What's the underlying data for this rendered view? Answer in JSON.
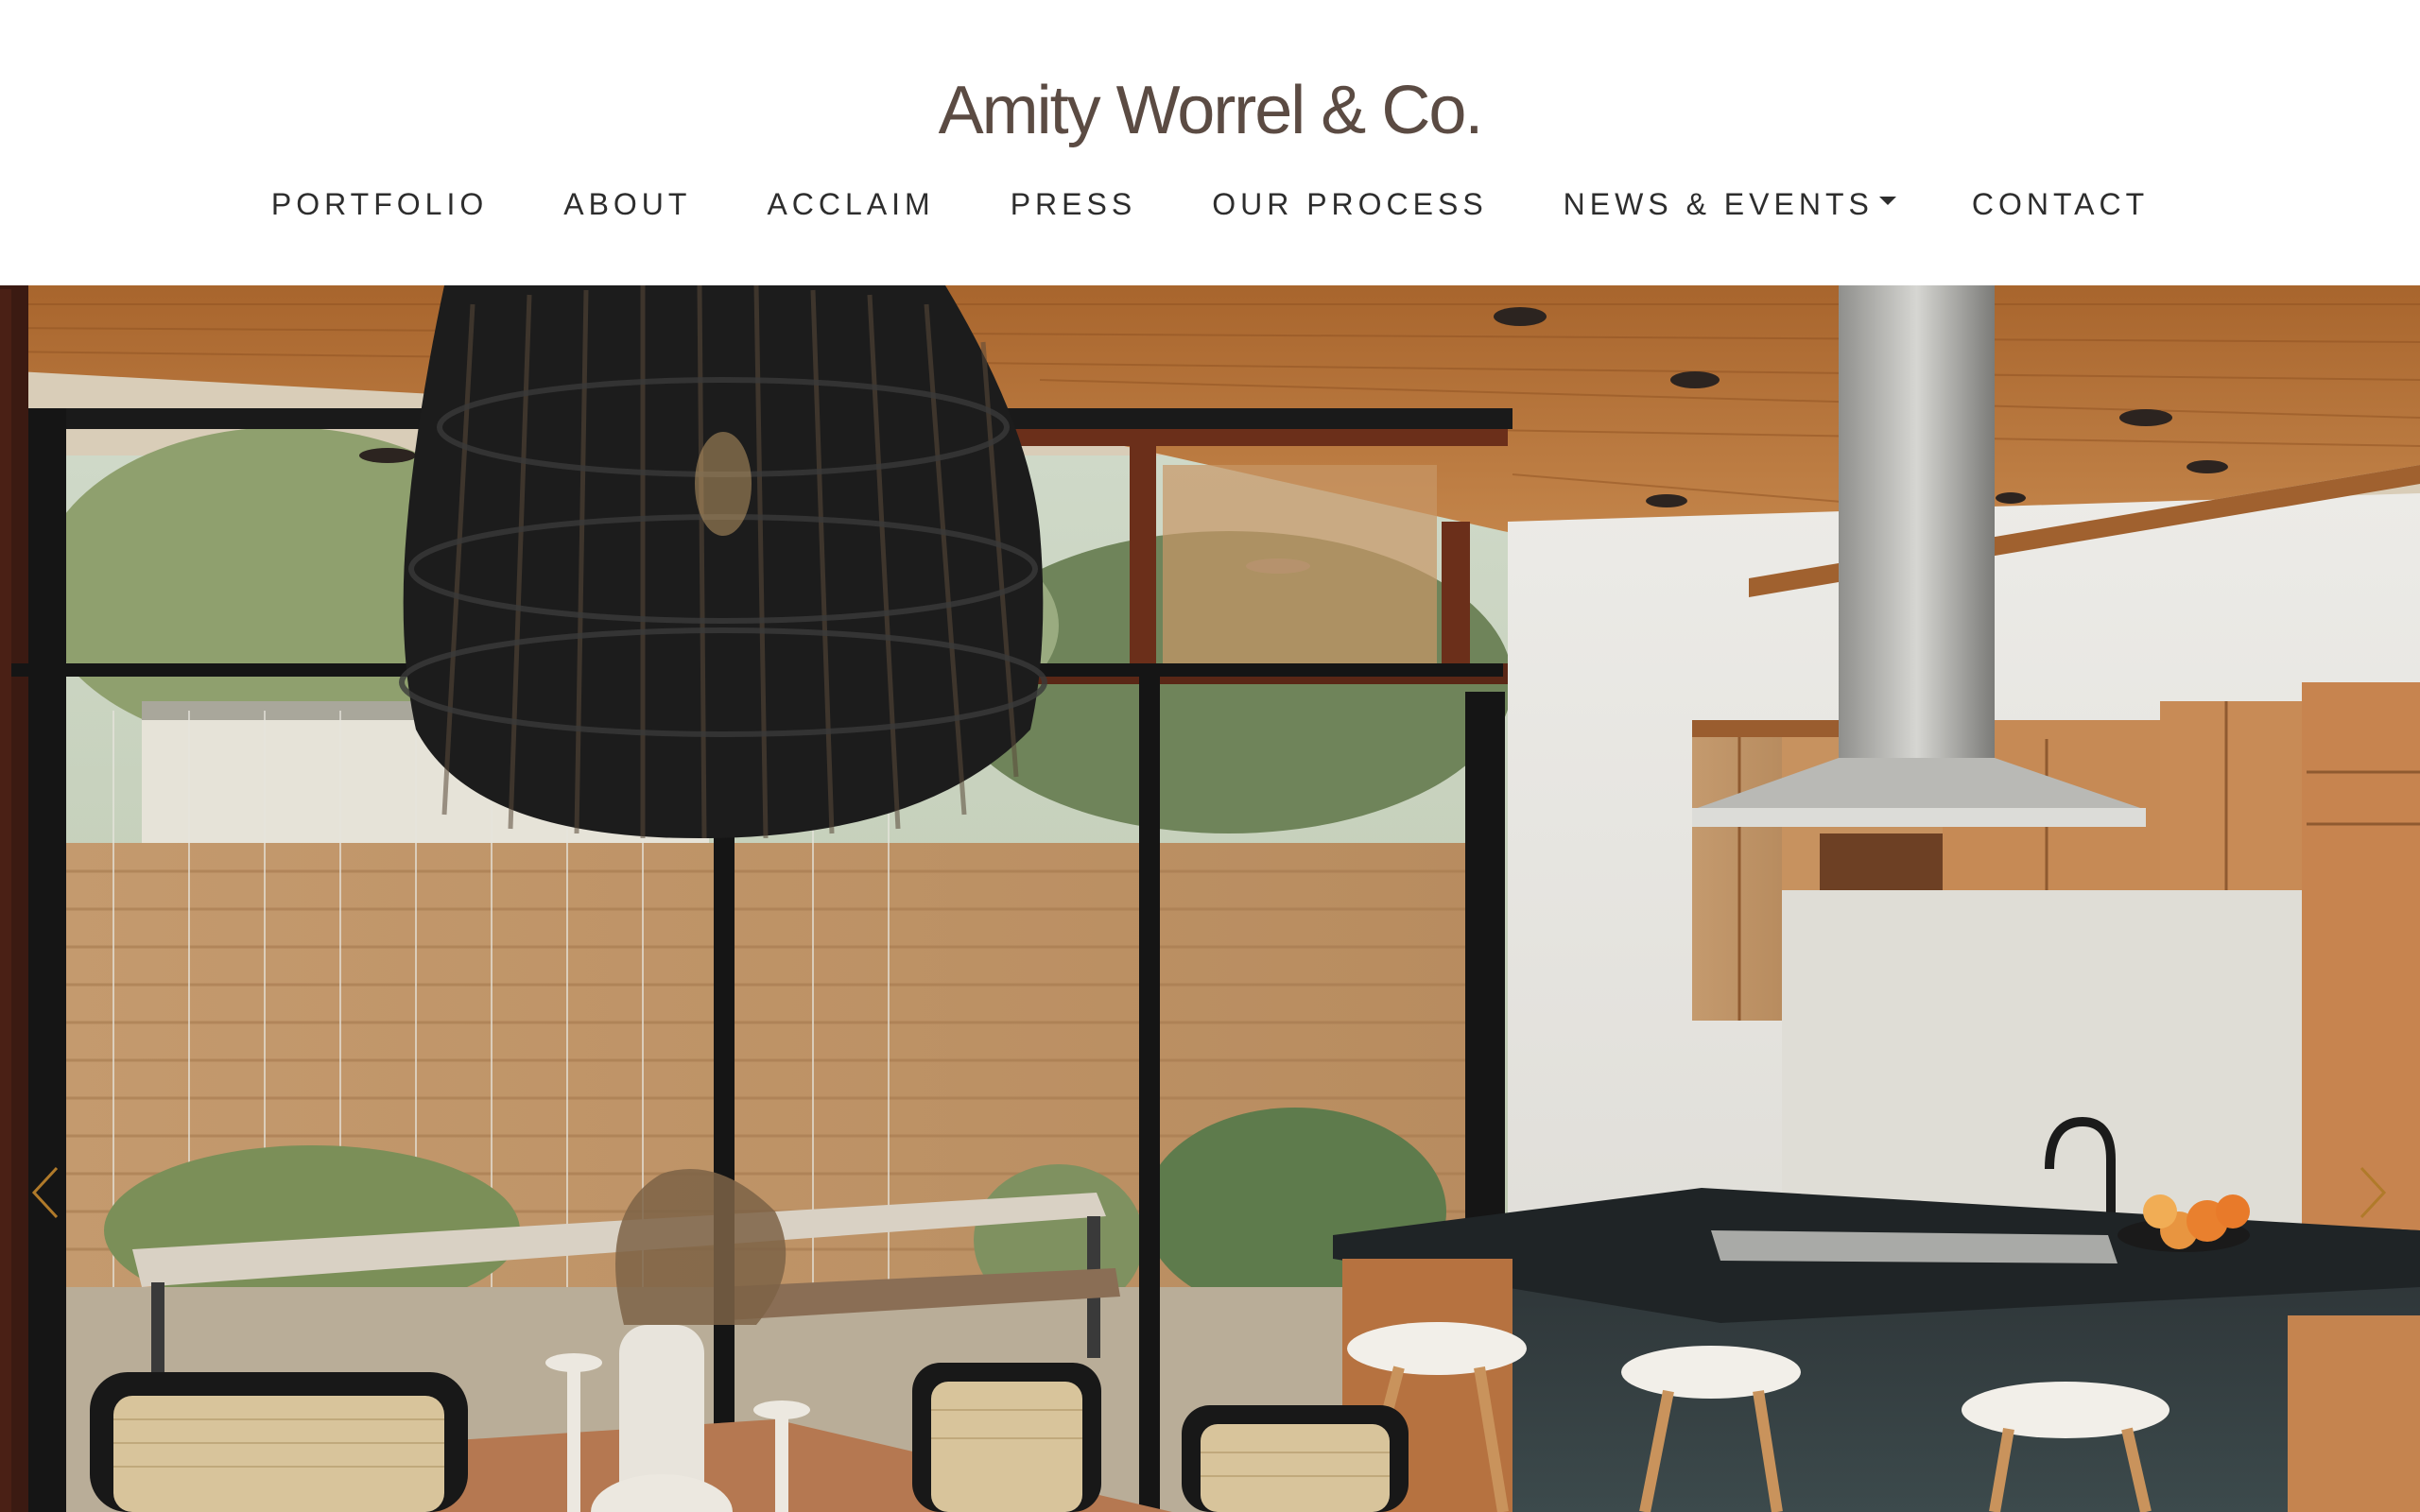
{
  "brand": {
    "name": "Amity Worrel & Co."
  },
  "nav": {
    "items": [
      {
        "label": "PORTFOLIO"
      },
      {
        "label": "ABOUT"
      },
      {
        "label": "ACCLAIM"
      },
      {
        "label": "PRESS"
      },
      {
        "label": "OUR PROCESS"
      },
      {
        "label": "NEWS & EVENTS",
        "has_dropdown": true
      },
      {
        "label": "CONTACT"
      }
    ]
  },
  "hero": {
    "icons": {
      "prev": "chevron-left-icon",
      "next": "chevron-right-icon"
    },
    "arrow_color": "#b07a2a"
  },
  "colors": {
    "logo": "#5b4b43",
    "nav_text": "#2d2d2d",
    "wood_ceiling": "#b9773d",
    "cabinet_wood": "#c6864e",
    "island_dark": "#23282b"
  }
}
